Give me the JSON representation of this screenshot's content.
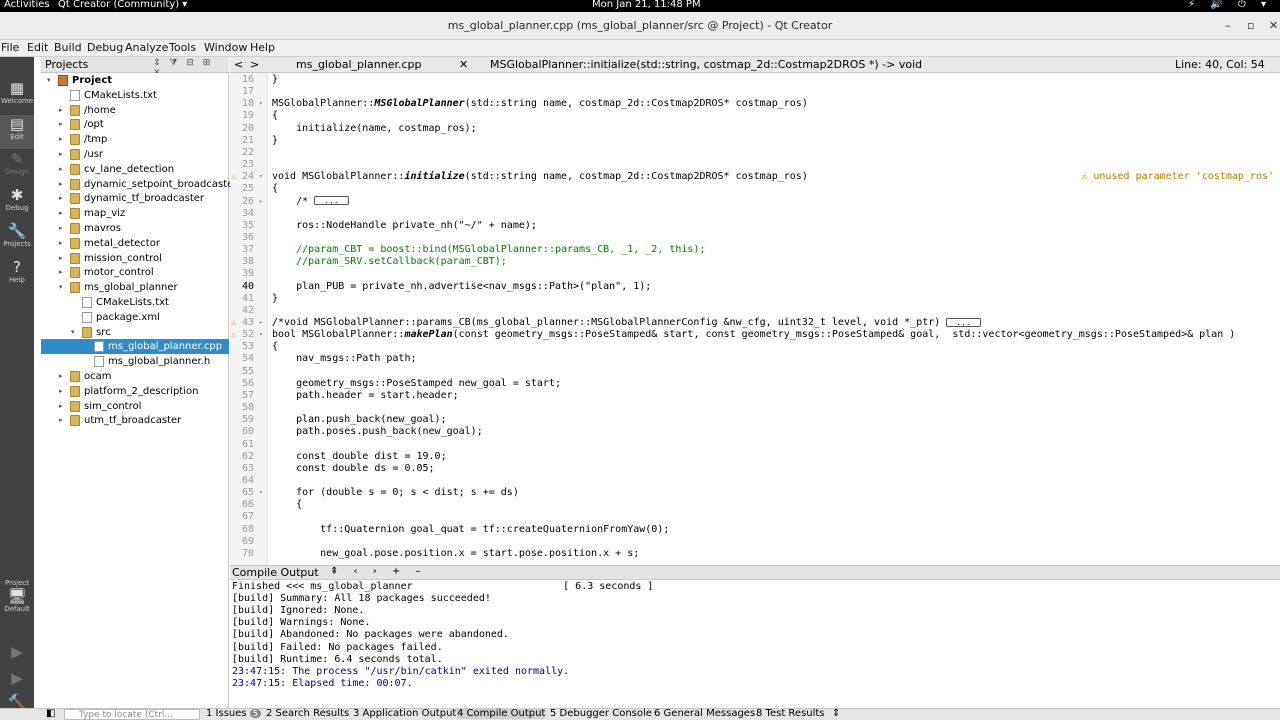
{
  "topbar": {
    "activities": "Activities",
    "app": "Qt Creator (Community) ▾",
    "clock": "Mon Jan 21, 11:48 PM",
    "tray": "⚡ 🔊 ⏻ ▾"
  },
  "window": {
    "title": "ms_global_planner.cpp (ms_global_planner/src @ Project) - Qt Creator",
    "minimize": "–",
    "maximize": "▫",
    "close": "✕"
  },
  "menu": [
    "File",
    "Edit",
    "Build",
    "Debug",
    "Analyze",
    "Tools",
    "Window",
    "Help"
  ],
  "modes": [
    {
      "label": "Welcome",
      "icon": "▦",
      "active": false,
      "dim": false
    },
    {
      "label": "Edit",
      "icon": "▤",
      "active": true,
      "dim": false
    },
    {
      "label": "Design",
      "icon": "✎",
      "active": false,
      "dim": true
    },
    {
      "label": "Debug",
      "icon": "✱",
      "active": false,
      "dim": false
    },
    {
      "label": "Projects",
      "icon": "🔧",
      "active": false,
      "dim": false
    },
    {
      "label": "Help",
      "icon": "?",
      "active": false,
      "dim": false
    }
  ],
  "kit": {
    "label1": "Project",
    "label2": "Default",
    "icon": "🖥"
  },
  "run_buttons": [
    "▶",
    "▶",
    "🔨"
  ],
  "projects_panel": {
    "title": "Projects",
    "tools": "⇕ ⧩ ⊟ ⊞ ✕",
    "items": [
      {
        "label": "Project",
        "depth": 0,
        "kind": "proj",
        "arrow": "▾",
        "selected": false
      },
      {
        "label": "CMakeLists.txt",
        "depth": 1,
        "kind": "file",
        "arrow": "",
        "selected": false
      },
      {
        "label": "/home",
        "depth": 1,
        "kind": "folder",
        "arrow": "▸",
        "selected": false
      },
      {
        "label": "/opt",
        "depth": 1,
        "kind": "folder",
        "arrow": "▸",
        "selected": false
      },
      {
        "label": "/tmp",
        "depth": 1,
        "kind": "folder",
        "arrow": "▸",
        "selected": false
      },
      {
        "label": "/usr",
        "depth": 1,
        "kind": "folder",
        "arrow": "▸",
        "selected": false
      },
      {
        "label": "cv_lane_detection",
        "depth": 1,
        "kind": "folder",
        "arrow": "▸",
        "selected": false
      },
      {
        "label": "dynamic_setpoint_broadcaster",
        "depth": 1,
        "kind": "folder",
        "arrow": "▸",
        "selected": false
      },
      {
        "label": "dynamic_tf_broadcaster",
        "depth": 1,
        "kind": "folder",
        "arrow": "▸",
        "selected": false
      },
      {
        "label": "map_viz",
        "depth": 1,
        "kind": "folder",
        "arrow": "▸",
        "selected": false
      },
      {
        "label": "mavros",
        "depth": 1,
        "kind": "folder",
        "arrow": "▸",
        "selected": false
      },
      {
        "label": "metal_detector",
        "depth": 1,
        "kind": "folder",
        "arrow": "▸",
        "selected": false
      },
      {
        "label": "mission_control",
        "depth": 1,
        "kind": "folder",
        "arrow": "▸",
        "selected": false
      },
      {
        "label": "motor_control",
        "depth": 1,
        "kind": "folder",
        "arrow": "▸",
        "selected": false
      },
      {
        "label": "ms_global_planner",
        "depth": 1,
        "kind": "folder",
        "arrow": "▾",
        "selected": false
      },
      {
        "label": "CMakeLists.txt",
        "depth": 2,
        "kind": "file",
        "arrow": "",
        "selected": false
      },
      {
        "label": "package.xml",
        "depth": 2,
        "kind": "file",
        "arrow": "",
        "selected": false
      },
      {
        "label": "src",
        "depth": 2,
        "kind": "folder",
        "arrow": "▾",
        "selected": false
      },
      {
        "label": "ms_global_planner.cpp",
        "depth": 3,
        "kind": "file",
        "arrow": "",
        "selected": true
      },
      {
        "label": "ms_global_planner.h",
        "depth": 3,
        "kind": "file",
        "arrow": "",
        "selected": false
      },
      {
        "label": "ocam",
        "depth": 1,
        "kind": "folder",
        "arrow": "▸",
        "selected": false
      },
      {
        "label": "platform_2_description",
        "depth": 1,
        "kind": "folder",
        "arrow": "▸",
        "selected": false
      },
      {
        "label": "sim_control",
        "depth": 1,
        "kind": "folder",
        "arrow": "▸",
        "selected": false
      },
      {
        "label": "utm_tf_broadcaster",
        "depth": 1,
        "kind": "folder",
        "arrow": "▸",
        "selected": false
      }
    ]
  },
  "editor_toolbar": {
    "back": "<",
    "forward": ">",
    "file": "ms_global_planner.cpp",
    "function": "MSGlobalPlanner::initialize(std::string, costmap_2d::Costmap2DROS *) -> void",
    "position": "Line: 40, Col: 54",
    "close": "✕"
  },
  "warning_text": "⚠ unused parameter 'costmap_ros'",
  "code_lines": [
    {
      "n": "16",
      "html": "}",
      "fold": "",
      "warn": false,
      "cls": ""
    },
    {
      "n": "17",
      "html": "",
      "fold": "",
      "warn": false,
      "cls": ""
    },
    {
      "n": "18",
      "html": "MSGlobalPlanner::<b>MSGlobalPlanner</b>(std::string name, costmap_2d::Costmap2DROS* costmap_ros)",
      "fold": "▾",
      "warn": false,
      "cls": ""
    },
    {
      "n": "19",
      "html": "{",
      "fold": "",
      "warn": false,
      "cls": ""
    },
    {
      "n": "20",
      "html": "    initialize(name, costmap_ros);",
      "fold": "",
      "warn": false,
      "cls": ""
    },
    {
      "n": "21",
      "html": "}",
      "fold": "",
      "warn": false,
      "cls": ""
    },
    {
      "n": "22",
      "html": "",
      "fold": "",
      "warn": false,
      "cls": ""
    },
    {
      "n": "23",
      "html": "",
      "fold": "",
      "warn": false,
      "cls": ""
    },
    {
      "n": "24",
      "html": "void MSGlobalPlanner::<b>initialize</b>(std::string name, costmap_2d::Costmap2DROS* costmap_ros)",
      "fold": "▾",
      "warn": true,
      "cls": ""
    },
    {
      "n": "25",
      "html": "{",
      "fold": "",
      "warn": false,
      "cls": ""
    },
    {
      "n": "26",
      "html": "    /* ",
      "fold": "▸",
      "warn": false,
      "cls": "folded",
      "box": "..."
    },
    {
      "n": "34",
      "html": "",
      "fold": "",
      "warn": false,
      "cls": ""
    },
    {
      "n": "35",
      "html": "    ros::NodeHandle private_nh(\"~/\" + name);",
      "fold": "",
      "warn": false,
      "cls": ""
    },
    {
      "n": "36",
      "html": "",
      "fold": "",
      "warn": false,
      "cls": ""
    },
    {
      "n": "37",
      "html": "    //param_CBT = boost::bind(MSGlobalPlanner::params_CB, _1, _2, this);",
      "fold": "",
      "warn": false,
      "cls": "comment"
    },
    {
      "n": "38",
      "html": "    //param_SRV.setCallback(param_CBT);",
      "fold": "",
      "warn": false,
      "cls": "comment"
    },
    {
      "n": "39",
      "html": "",
      "fold": "",
      "warn": false,
      "cls": ""
    },
    {
      "n": "40",
      "html": "    plan_PUB = private_nh.advertise<nav_msgs::Path>(\"plan\", 1);",
      "fold": "",
      "warn": false,
      "cls": "",
      "cur": true
    },
    {
      "n": "41",
      "html": "}",
      "fold": "",
      "warn": false,
      "cls": ""
    },
    {
      "n": "42",
      "html": "",
      "fold": "",
      "warn": false,
      "cls": ""
    },
    {
      "n": "43",
      "html": "/*void MSGlobalPlanner::params_CB(ms_global_planner::MSGlobalPlannerConfig &nw_cfg, uint32_t level, void *_ptr) ",
      "fold": "▸",
      "warn": true,
      "cls": "folded",
      "box": "..."
    },
    {
      "n": "52",
      "html": "bool MSGlobalPlanner::<b>makePlan</b>(const geometry_msgs::PoseStamped& start, const geometry_msgs::PoseStamped& goal,  std::vector<geometry_msgs::PoseStamped>& plan )",
      "fold": "▾",
      "warn": true,
      "cls": ""
    },
    {
      "n": "53",
      "html": "{",
      "fold": "",
      "warn": false,
      "cls": ""
    },
    {
      "n": "54",
      "html": "    nav_msgs::Path path;",
      "fold": "",
      "warn": false,
      "cls": ""
    },
    {
      "n": "55",
      "html": "",
      "fold": "",
      "warn": false,
      "cls": ""
    },
    {
      "n": "56",
      "html": "    geometry_msgs::PoseStamped new_goal = start;",
      "fold": "",
      "warn": false,
      "cls": ""
    },
    {
      "n": "57",
      "html": "    path.header = start.header;",
      "fold": "",
      "warn": false,
      "cls": ""
    },
    {
      "n": "58",
      "html": "",
      "fold": "",
      "warn": false,
      "cls": ""
    },
    {
      "n": "59",
      "html": "    plan.push_back(new_goal);",
      "fold": "",
      "warn": false,
      "cls": ""
    },
    {
      "n": "60",
      "html": "    path.poses.push_back(new_goal);",
      "fold": "",
      "warn": false,
      "cls": ""
    },
    {
      "n": "61",
      "html": "",
      "fold": "",
      "warn": false,
      "cls": ""
    },
    {
      "n": "62",
      "html": "    const double dist = 19.0;",
      "fold": "",
      "warn": false,
      "cls": ""
    },
    {
      "n": "63",
      "html": "    const double ds = 0.05;",
      "fold": "",
      "warn": false,
      "cls": ""
    },
    {
      "n": "64",
      "html": "",
      "fold": "",
      "warn": false,
      "cls": ""
    },
    {
      "n": "65",
      "html": "    for (double s = 0; s < dist; s += ds)",
      "fold": "▾",
      "warn": false,
      "cls": ""
    },
    {
      "n": "66",
      "html": "    {",
      "fold": "",
      "warn": false,
      "cls": ""
    },
    {
      "n": "67",
      "html": "",
      "fold": "",
      "warn": false,
      "cls": ""
    },
    {
      "n": "68",
      "html": "        tf::Quaternion goal_quat = tf::createQuaternionFromYaw(0);",
      "fold": "",
      "warn": false,
      "cls": ""
    },
    {
      "n": "69",
      "html": "",
      "fold": "",
      "warn": false,
      "cls": ""
    },
    {
      "n": "70",
      "html": "        new_goal.pose.position.x = start.pose.position.x + s;",
      "fold": "",
      "warn": false,
      "cls": ""
    }
  ],
  "output_panel": {
    "title": "Compile Output",
    "tools": "⇞ ‹ › + –",
    "lines": [
      {
        "text": "Finished <<< ms_global_planner                         [ 6.3 seconds ]",
        "cls": ""
      },
      {
        "text": "[build] Summary: All 18 packages succeeded!",
        "cls": ""
      },
      {
        "text": "[build] Ignored: None.",
        "cls": ""
      },
      {
        "text": "[build] Warnings: None.",
        "cls": ""
      },
      {
        "text": "[build] Abandoned: No packages were abandoned.",
        "cls": ""
      },
      {
        "text": "[build] Failed: No packages failed.",
        "cls": ""
      },
      {
        "text": "[build] Runtime: 6.4 seconds total.",
        "cls": ""
      },
      {
        "text": "23:47:15: The process \"/usr/bin/catkin\" exited normally.",
        "cls": "blue"
      },
      {
        "text": "23:47:15: Elapsed time: 00:07.",
        "cls": "blue"
      }
    ]
  },
  "statusbar": {
    "locate_placeholder": "Type to locate (Ctrl...",
    "tabs": [
      {
        "label": "1 Issues",
        "badge": "5"
      },
      {
        "label": "2 Search Results",
        "badge": ""
      },
      {
        "label": "3 Application Output",
        "badge": ""
      },
      {
        "label": "4 Compile Output",
        "badge": ""
      },
      {
        "label": "5 Debugger Console",
        "badge": ""
      },
      {
        "label": "6 General Messages",
        "badge": ""
      },
      {
        "label": "8 Test Results",
        "badge": ""
      }
    ],
    "more": "⇕"
  }
}
